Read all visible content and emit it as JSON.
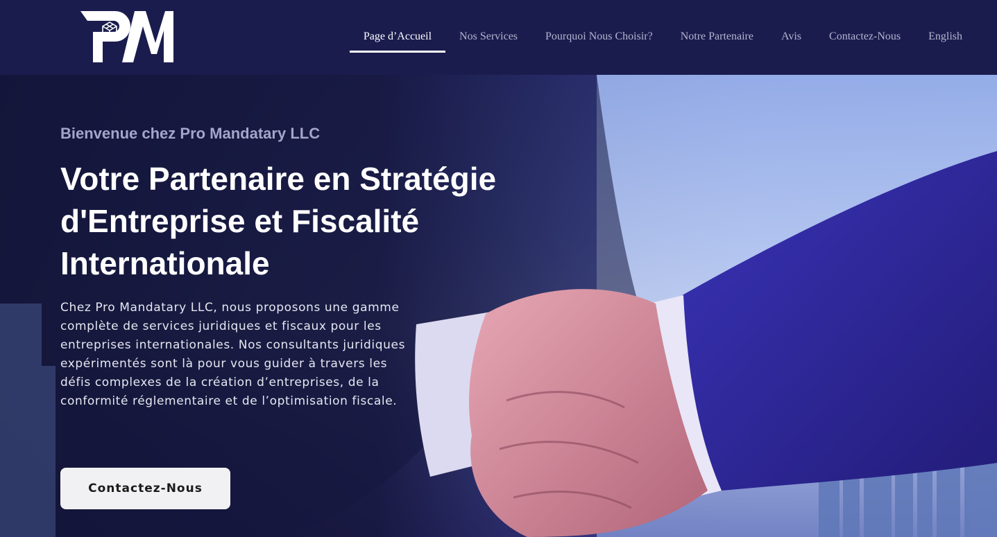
{
  "brand": {
    "logo_text": "PM"
  },
  "nav": {
    "items": [
      {
        "label": "Page d’Accueil",
        "active": true
      },
      {
        "label": "Nos Services",
        "active": false
      },
      {
        "label": "Pourquoi Nous Choisir?",
        "active": false
      },
      {
        "label": "Notre Partenaire",
        "active": false
      },
      {
        "label": "Avis",
        "active": false
      },
      {
        "label": "Contactez-Nous",
        "active": false
      },
      {
        "label": "English",
        "active": false
      }
    ]
  },
  "hero": {
    "kicker": "Bienvenue chez Pro Mandatary LLC",
    "title": "Votre Partenaire en Stratégie d'Entreprise et Fiscalité Internationale",
    "description": "Chez Pro Mandatary LLC, nous proposons une gamme complète de services juridiques et fiscaux pour les entreprises internationales. Nos consultants juridiques expérimentés sont là pour vous guider à travers les défis complexes de la création d’entreprises, de la conformité réglementaire et de l’optimisation fiscale.",
    "cta_label": "Contactez-Nous",
    "background_image": "handshake-icon"
  },
  "colors": {
    "nav_bg": "#1b1c4e",
    "accent": "#ffffff",
    "button_bg": "#f1f1f3"
  }
}
